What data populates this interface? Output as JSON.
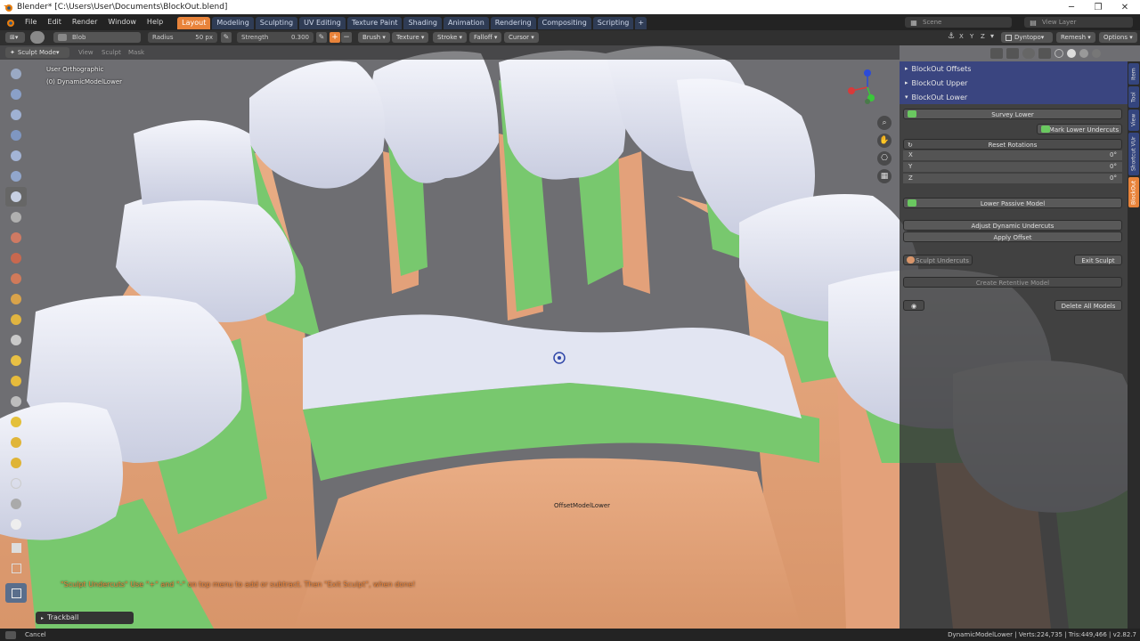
{
  "title_bar": {
    "text": "Blender* [C:\\Users\\User\\Documents\\BlockOut.blend]"
  },
  "menus": [
    "File",
    "Edit",
    "Render",
    "Window",
    "Help"
  ],
  "workspace_tabs": [
    "Layout",
    "Modeling",
    "Sculpting",
    "UV Editing",
    "Texture Paint",
    "Shading",
    "Animation",
    "Rendering",
    "Compositing",
    "Scripting"
  ],
  "active_workspace": "Layout",
  "scene": {
    "label": "Scene",
    "view_layer": "View Layer"
  },
  "tool_header": {
    "brush_name": "Blob",
    "radius_label": "Radius",
    "radius_value": "50 px",
    "strength_label": "Strength",
    "strength_value": "0.300",
    "dropdowns": [
      "Brush",
      "Texture",
      "Stroke",
      "Falloff",
      "Cursor"
    ],
    "axis": [
      "X",
      "Y",
      "Z"
    ],
    "dyntopo": "Dyntopo",
    "remesh": "Remesh",
    "options": "Options"
  },
  "mode_header": {
    "mode": "Sculpt Mode",
    "menus": [
      "View",
      "Sculpt",
      "Mask"
    ]
  },
  "viewport": {
    "view_name": "User Orthographic",
    "object_name": "(0) DynamicModelLower",
    "object_label": "OffsetModelLower",
    "hint": "\"Sculpt Undercuts\" Use \"+\" and \"-\" on top menu to add or subtract. Then \"Exit Sculpt\", when done!",
    "colors": {
      "tooth": "#dde1ef",
      "undercut": "#78c86e",
      "offset": "#e6a57c"
    }
  },
  "npanel": {
    "sections": [
      "BlockOut Offsets",
      "BlockOut Upper",
      "BlockOut Lower"
    ],
    "survey": "Survey Lower",
    "mark": "Mark Lower Undercuts",
    "reset": "Reset Rotations",
    "rot_axes": [
      {
        "axis": "X",
        "value": "0°"
      },
      {
        "axis": "Y",
        "value": "0°"
      },
      {
        "axis": "Z",
        "value": "0°"
      }
    ],
    "passive": "Lower Passive Model",
    "adjust": "Adjust Dynamic Undercuts",
    "apply": "Apply Offset",
    "sculpt": "Sculpt Undercuts",
    "exit": "Exit Sculpt",
    "retentive": "Create Retentive Model",
    "delete": "Delete All Models"
  },
  "side_tabs": [
    "Item",
    "Tool",
    "View",
    "Shortcut VUr",
    "BlockOut"
  ],
  "active_side_tab": "BlockOut",
  "last_operator": "Trackball",
  "status": {
    "left": "Cancel",
    "right": "DynamicModelLower | Verts:224,735 | Tris:449,466 | v2.82.7"
  }
}
